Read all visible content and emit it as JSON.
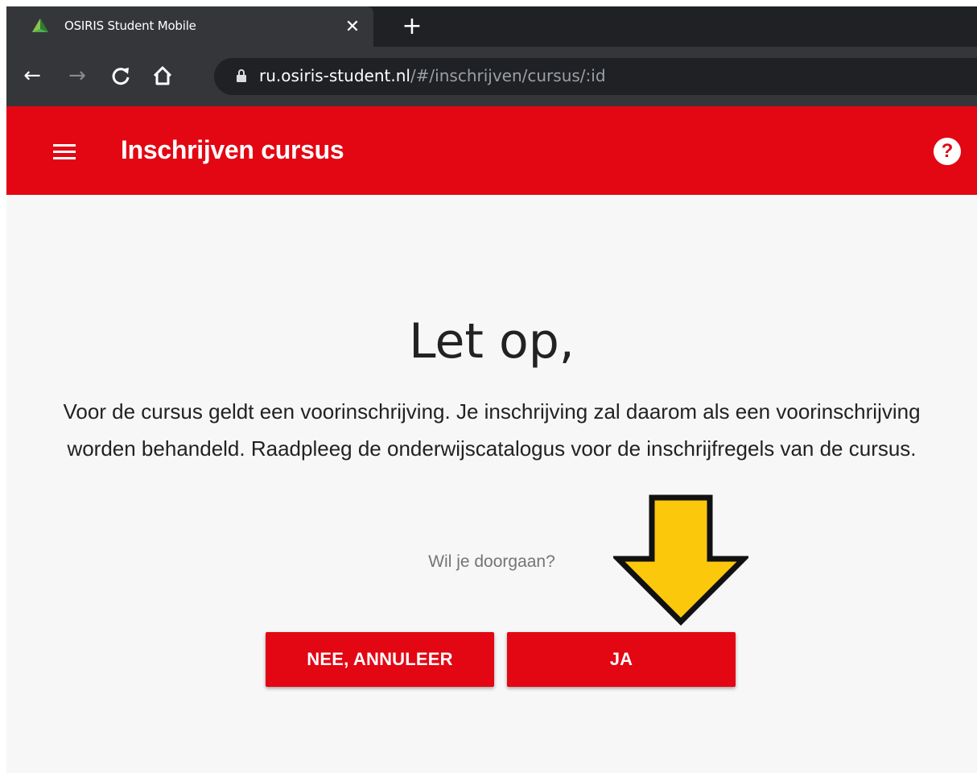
{
  "browser": {
    "tab_title": "OSIRIS Student Mobile",
    "tab_close": "✕",
    "new_tab": "+",
    "url_host": "ru.osiris-student.nl",
    "url_path": "/#/inschrijven/cursus/:id",
    "icons": [
      "back-icon",
      "forward-icon",
      "reload-icon",
      "home-icon",
      "lock-icon"
    ]
  },
  "header": {
    "title": "Inschrijven cursus",
    "help_symbol": "?",
    "background": "#e30613"
  },
  "dialog": {
    "heading": "Let op,",
    "message": "Voor de cursus geldt een voorinschrijving. Je inschrijving zal daarom als een voorinschrijving worden behandeld. Raadpleeg de onderwijscatalogus voor de inschrijfregels van de cursus.",
    "question": "Wil je doorgaan?",
    "cancel_label": "NEE, ANNULEER",
    "confirm_label": "JA"
  },
  "annotation": {
    "arrow_color": "#fcc80c",
    "arrow_outline": "#111111"
  }
}
